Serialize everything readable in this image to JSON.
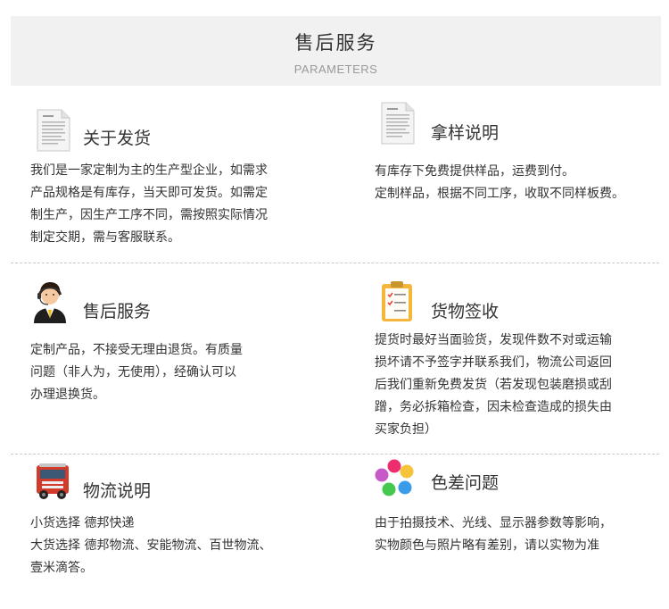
{
  "header": {
    "title": "售后服务",
    "subtitle": "PARAMETERS"
  },
  "sections": {
    "shipping": {
      "icon": "document-icon",
      "title": "关于发货",
      "lines": [
        "我们是一家定制为主的生产型企业，如需求",
        "产品规格是有库存，当天即可发货。如需定",
        "制生产，因生产工序不同，需按照实际情况",
        "制定交期，需与客服联系。"
      ]
    },
    "samples": {
      "icon": "document-icon",
      "title": "拿样说明",
      "lines": [
        "有库存下免费提供样品，运费到付。",
        "定制样品，根据不同工序，收取不同样板费。"
      ]
    },
    "aftersales": {
      "icon": "service-agent-icon",
      "title": "售后服务",
      "lines": [
        "定制产品，不接受无理由退货。有质量",
        "问题（非人为，无使用），经确认可以",
        "办理退换货。"
      ]
    },
    "receipt": {
      "icon": "clipboard-checklist-icon",
      "title": "货物签收",
      "lines": [
        "提货时最好当面验货，发现件数不对或运输",
        "损坏请不予签字并联系我们，物流公司返回",
        "后我们重新免费发货（若发现包装磨损或刮",
        "蹭，务必拆箱检查，因未检查造成的损失由",
        "买家负担）"
      ]
    },
    "logistics": {
      "icon": "delivery-truck-icon",
      "title": "物流说明",
      "lines": [
        "小货选择 德邦快递",
        "大货选择 德邦物流、安能物流、百世物流、",
        "壹米滴答。"
      ]
    },
    "color": {
      "icon": "color-dots-icon",
      "title": "色差问题",
      "lines": [
        "由于拍摄技术、光线、显示器参数等影响，",
        "实物颜色与照片略有差别，请以实物为准"
      ]
    }
  },
  "colors": {
    "dots": [
      "#ee2d6e",
      "#f7c33a",
      "#3a9be8",
      "#44c84e",
      "#c85ac8",
      "#2c6de0"
    ]
  }
}
